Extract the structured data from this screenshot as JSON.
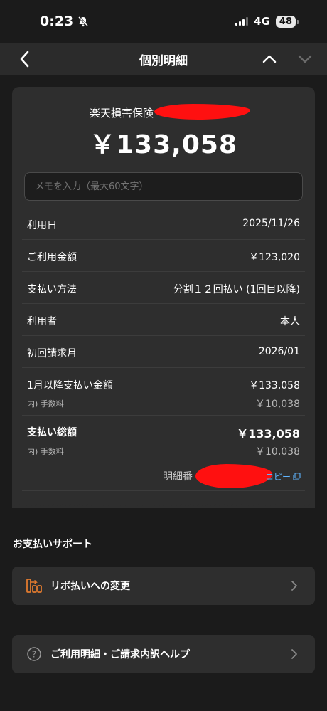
{
  "status_bar": {
    "time": "0:23",
    "network": "4G",
    "battery": "48"
  },
  "nav": {
    "title": "個別明細"
  },
  "detail": {
    "merchant": "楽天損害保険",
    "amount": "￥133,058",
    "memo_placeholder": "メモを入力（最大60文字）",
    "rows": [
      {
        "label": "利用日",
        "value": "2025/11/26"
      },
      {
        "label": "ご利用金額",
        "value": "￥123,020"
      },
      {
        "label": "支払い方法",
        "value": "分割１２回払い (1回目以降)"
      },
      {
        "label": "利用者",
        "value": "本人"
      },
      {
        "label": "初回請求月",
        "value": "2026/01"
      }
    ],
    "monthly": {
      "label": "1月以降支払い金額",
      "value": "￥133,058",
      "fee_label": "内) 手数料",
      "fee_value": "￥10,038"
    },
    "total": {
      "label": "支払い総額",
      "value": "￥133,058",
      "fee_label": "内) 手数料",
      "fee_value": "￥10,038"
    },
    "reference_label": "明細番",
    "copy_label": "コピー"
  },
  "support": {
    "title": "お支払いサポート",
    "revolving": "リボ払いへの変更",
    "help": "ご利用明細・ご請求内訳ヘルプ"
  },
  "colors": {
    "background": "#1b1b1b",
    "card": "#2e2e2e",
    "link": "#5fb4ff",
    "accent_orange": "#e07a2f",
    "redaction": "#ff1010"
  }
}
